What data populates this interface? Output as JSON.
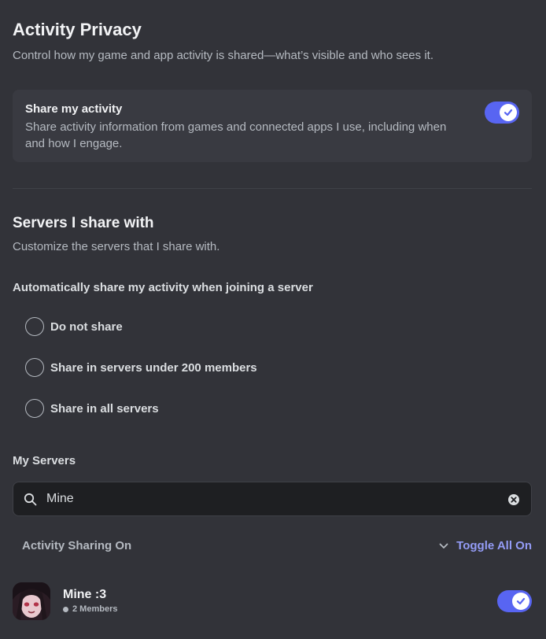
{
  "header": {
    "title": "Activity Privacy",
    "subtitle": "Control how my game and app activity is shared—what’s visible and who sees it."
  },
  "share_activity": {
    "title": "Share my activity",
    "description": "Share activity information from games and connected apps I use, including when and how I engage.",
    "enabled": true
  },
  "servers_section": {
    "title": "Servers I share with",
    "subtitle": "Customize the servers that I share with.",
    "auto_label": "Automatically share my activity when joining a server",
    "options": [
      {
        "label": "Do not share",
        "selected": false
      },
      {
        "label": "Share in servers under 200 members",
        "selected": false
      },
      {
        "label": "Share in all servers",
        "selected": false
      }
    ]
  },
  "my_servers": {
    "title": "My Servers",
    "search_value": "Mine",
    "group_label": "Activity Sharing On",
    "toggle_all_label": "Toggle All On",
    "servers": [
      {
        "name": "Mine :3",
        "members": "2 Members",
        "enabled": true
      }
    ]
  },
  "colors": {
    "background": "#323339",
    "card": "#393a41",
    "accent": "#5865f2",
    "link": "#949cf7"
  },
  "icons": {
    "search": "search-icon",
    "clear": "clear-icon",
    "chevron": "chevron-down-icon",
    "check": "check-icon"
  }
}
